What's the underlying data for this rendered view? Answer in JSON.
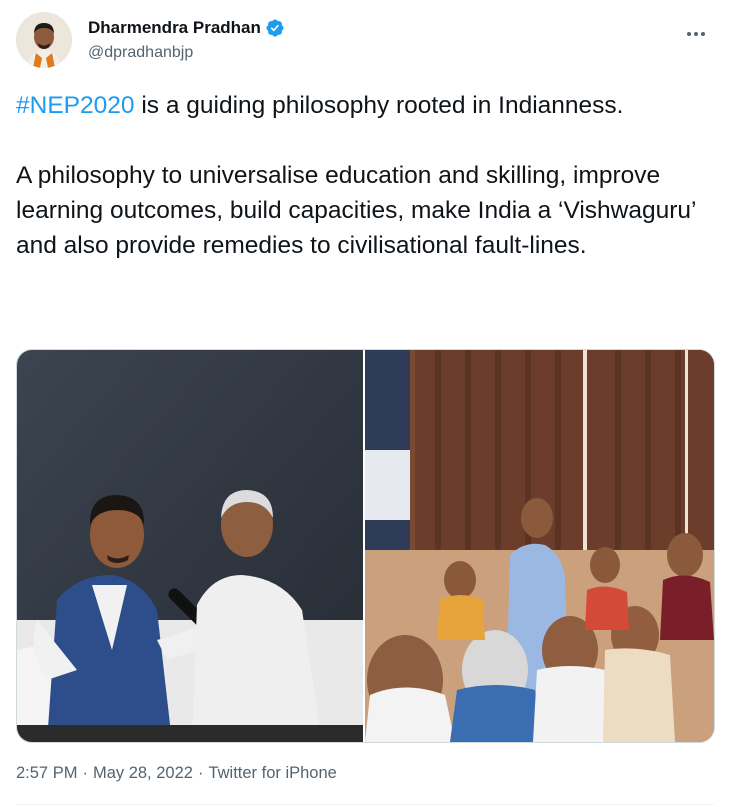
{
  "author": {
    "name": "Dharmendra Pradhan",
    "handle": "@dpradhanbjp",
    "verified": true
  },
  "tweet": {
    "hashtag": "#NEP2020",
    "line1_rest": " is a guiding philosophy rooted in Indianness.",
    "paragraph2": "A philosophy to universalise education and skilling, improve learning outcomes, build capacities, make India a ‘Vishwaguru’ and also provide remedies to civilisational fault-lines."
  },
  "media": {
    "photos": [
      {
        "description_icon": "photo-icon"
      },
      {
        "description_icon": "photo-icon"
      }
    ]
  },
  "meta": {
    "time": "2:57 PM",
    "separator": "·",
    "date": "May 28, 2022",
    "source": "Twitter for iPhone"
  },
  "colors": {
    "accent": "#1d9bf0",
    "secondary_text": "#536471",
    "verified_badge": "#1d9bf0"
  }
}
